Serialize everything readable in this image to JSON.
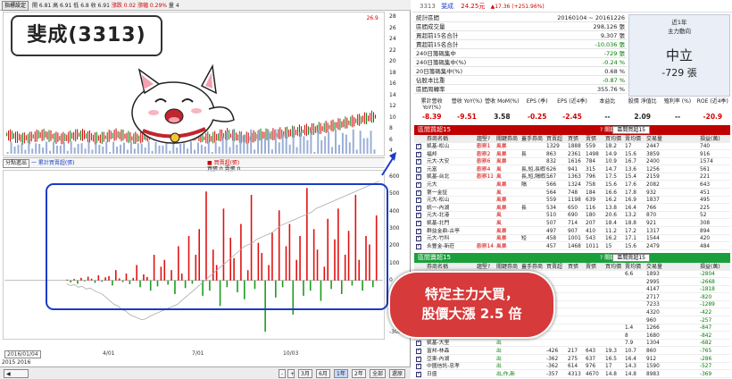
{
  "left": {
    "topbar": {
      "btn": "指標設定",
      "text": "開 6.81  高 6.91  低 6.8  收 6.91",
      "change": "漲跌 0.02  漲幅 0.29%",
      "vol": "量 4"
    },
    "title": "斐成(3313)",
    "price_axis": [
      "28",
      "26",
      "24",
      "22",
      "20",
      "18",
      "16",
      "14",
      "12",
      "10",
      "8",
      "6",
      "4"
    ],
    "price_tag": "26.9",
    "mid_bar": {
      "sel": "分點進出",
      "legend1": "一 累計買賣超(張)",
      "legend2": "■ 買賣超(張)",
      "legend3": "買張 0  賣張 0"
    },
    "vol_axis": [
      "600",
      "500",
      "400",
      "300",
      "200",
      "100",
      "0",
      "-100",
      "-200",
      "-300"
    ],
    "dates": [
      "2016/01/04",
      "4/01",
      "7/01",
      "10/03"
    ],
    "date_sub": "2015  2016",
    "bottom_buttons": [
      "3月",
      "6月",
      "1年",
      "2年",
      "全部",
      "還原"
    ]
  },
  "right": {
    "header": {
      "code": "3313",
      "name": "斐成",
      "price": "24.25元",
      "change": "▲17.36 (+251.96%)"
    },
    "stats": [
      {
        "k": "統計區間",
        "v": "20160104 ~ 20161226"
      },
      {
        "k": "區間成交量",
        "v": "298,126 張"
      },
      {
        "k": "買超前15名合計",
        "v": "9,307 張"
      },
      {
        "k": "賣超前15名合計",
        "v": "-10,036 張"
      },
      {
        "k": "240日籌碼集中",
        "v": "-729 張"
      },
      {
        "k": "240日籌碼集中(%)",
        "v": "-0.24 %"
      },
      {
        "k": "20日籌碼集中(%)",
        "v": "0.68 %"
      },
      {
        "k": "佔股本比重",
        "v": "-0.87 %"
      },
      {
        "k": "區間周轉率",
        "v": "355.76 %"
      }
    ],
    "trend": {
      "t1": "近1年",
      "t2": "主力動向",
      "t3": "中立",
      "t4": "-729 張"
    },
    "ratios": {
      "labels": [
        "累計營收 YoY(%)",
        "營收 YoY(%)",
        "營收 MoM(%)",
        "EPS (季)",
        "EPS (近4季)",
        "本益比",
        "股價 淨值比",
        "殖利率 (%)",
        "ROE (近4季)"
      ],
      "values": [
        "-8.39",
        "-9.51",
        "3.58",
        "-0.25",
        "-2.45",
        "--",
        "2.09",
        "--",
        "-20.9"
      ]
    },
    "buy": {
      "title": "區間買超15",
      "select": "區間買超15",
      "hint": "? 關鍵券商:",
      "cols": [
        "券商名稱",
        "趨堅?",
        "關鍵券商",
        "蓋手券商",
        "買賣超",
        "買張",
        "賣張",
        "買均價",
        "賣均價",
        "交易量",
        "損益(萬)"
      ],
      "rows": [
        [
          "凱基-松山",
          "觀察1",
          "風暴",
          "",
          "1329",
          "1888",
          "559",
          "18.2",
          "17",
          "2447",
          "740"
        ],
        [
          "福邦",
          "觀察2",
          "風暴",
          "長",
          "863",
          "2361",
          "1498",
          "14.9",
          "15.6",
          "3859",
          "916"
        ],
        [
          "元大-大安",
          "觀察6",
          "風暴",
          "",
          "832",
          "1616",
          "784",
          "10.9",
          "16.7",
          "2400",
          "1574"
        ],
        [
          "元富",
          "觀察4",
          "風",
          "長,短,長暇",
          "626",
          "941",
          "315",
          "14.7",
          "13.6",
          "1256",
          "561"
        ],
        [
          "凱基-台北",
          "觀察11",
          "風",
          "長,短,隔暇...",
          "567",
          "1363",
          "796",
          "17.5",
          "15.4",
          "2159",
          "221"
        ],
        [
          "元大",
          "",
          "風暴",
          "隔",
          "566",
          "1324",
          "758",
          "15.6",
          "17.6",
          "2082",
          "643"
        ],
        [
          "第一金証",
          "",
          "風",
          "",
          "564",
          "748",
          "184",
          "16.6",
          "17.8",
          "932",
          "451"
        ],
        [
          "元大-松山",
          "",
          "風暴",
          "",
          "559",
          "1198",
          "639",
          "16.2",
          "16.9",
          "1837",
          "495"
        ],
        [
          "統一-內湖",
          "",
          "風暴",
          "長",
          "534",
          "650",
          "116",
          "13.8",
          "16.4",
          "766",
          "225"
        ],
        [
          "元大-北港",
          "",
          "風",
          "",
          "510",
          "690",
          "180",
          "20.6",
          "13.2",
          "870",
          "52"
        ],
        [
          "凱基-北門",
          "",
          "風",
          "",
          "507",
          "714",
          "207",
          "18.4",
          "18.8",
          "921",
          "308"
        ],
        [
          "群益金鼎-古亭",
          "",
          "風暴",
          "",
          "497",
          "907",
          "410",
          "11.2",
          "17.2",
          "1317",
          "894"
        ],
        [
          "元大-竹科",
          "",
          "風暴",
          "短",
          "458",
          "1001",
          "543",
          "16.2",
          "17.1",
          "1544",
          "420"
        ],
        [
          "永豐金-新莊",
          "觀察14",
          "風暴",
          "",
          "457",
          "1468",
          "1011",
          "15",
          "15.6",
          "2479",
          "484"
        ]
      ]
    },
    "sell": {
      "title": "區間賣超15",
      "select": "區間賣超15",
      "hint": "? 關鍵券商:",
      "cols": [
        "券商名稱",
        "趨堅?",
        "關鍵券商",
        "蓋手券商",
        "買賣超",
        "買張",
        "賣張",
        "買均價",
        "賣均價",
        "交易量",
        "損益(萬)"
      ],
      "rows": [
        [
          "",
          "",
          "",
          "",
          "",
          "",
          "",
          "",
          "6.6",
          "1893",
          "-2804"
        ],
        [
          "",
          "",
          "",
          "",
          "",
          "",
          "",
          "",
          "",
          "2995",
          "-2668"
        ],
        [
          "",
          "",
          "",
          "",
          "",
          "",
          "",
          "",
          "",
          "4147",
          "-1818"
        ],
        [
          "",
          "",
          "",
          "",
          "",
          "",
          "",
          "",
          "",
          "2717",
          "-820"
        ],
        [
          "",
          "",
          "",
          "",
          "",
          "",
          "",
          "",
          "",
          "7233",
          "-1289"
        ],
        [
          "",
          "",
          "",
          "",
          "",
          "",
          "",
          "",
          "",
          "4320",
          "-422"
        ],
        [
          "",
          "",
          "",
          "",
          "",
          "",
          "",
          "",
          "",
          "960",
          "-257"
        ],
        [
          "",
          "",
          "",
          "",
          "",
          "",
          "",
          "",
          "1.4",
          "1266",
          "-847"
        ],
        [
          "",
          "",
          "",
          "",
          "",
          "",
          "",
          "",
          "8",
          "1680",
          "-842"
        ],
        [
          "凱基-大里",
          "",
          "出",
          "",
          "",
          "",
          "",
          "",
          "7.9",
          "1304",
          "-682"
        ],
        [
          "富邦-林森",
          "",
          "出",
          "",
          "-426",
          "217",
          "643",
          "19.3",
          "10.7",
          "860",
          "-765"
        ],
        [
          "亞東-內湖",
          "",
          "出",
          "",
          "-362",
          "275",
          "637",
          "16.5",
          "16.4",
          "912",
          "-286"
        ],
        [
          "中國信託-忠孝",
          "",
          "出",
          "",
          "-362",
          "614",
          "976",
          "17",
          "14.3",
          "1590",
          "-527"
        ],
        [
          "日盛",
          "",
          "出,作,新",
          "",
          "-357",
          "4313",
          "4670",
          "14.8",
          "14.8",
          "8983",
          "-369"
        ]
      ]
    }
  },
  "callout": {
    "line1": "特定主力大買，",
    "line2": "股價大漲 2.5 倍"
  },
  "chart_data": {
    "type": "bar",
    "title": "",
    "xlabel": "",
    "ylabel": "",
    "ylim": [
      -300,
      600
    ],
    "series": [
      {
        "name": "買賣超(張)",
        "values": [
          5,
          -12,
          8,
          -20,
          15,
          -6,
          22,
          10,
          -15,
          30,
          -8,
          18,
          25,
          -30,
          60,
          12,
          -10,
          40,
          -22,
          15,
          90,
          -40,
          35,
          20,
          -60,
          150,
          -35,
          80,
          120,
          -25,
          60,
          -80,
          200,
          40,
          -45,
          260,
          -20,
          150,
          300,
          -90,
          520,
          -60,
          180,
          90,
          -150,
          420,
          -40,
          250,
          130,
          -70,
          330,
          -110,
          60,
          500,
          -50,
          220,
          160,
          -300,
          90,
          280,
          -100,
          410,
          -40,
          200,
          330,
          -200,
          120,
          260,
          -90,
          540,
          -60,
          300,
          180,
          -120,
          80,
          360,
          -50,
          240,
          420,
          -80,
          150,
          290,
          -30,
          500,
          120,
          -60,
          260,
          210,
          -40,
          380
        ]
      },
      {
        "name": "累計買賣超(張)",
        "values": [
          -20,
          -30,
          -25,
          -40,
          -35,
          -50,
          -45,
          -60,
          -70,
          -80,
          -100,
          -120,
          -140,
          -150,
          -170,
          -180,
          -200,
          -210,
          -220,
          -230,
          -225,
          -210,
          -200,
          -190,
          -180,
          -170,
          -160,
          -150,
          -140,
          -120,
          -100,
          -80,
          -60,
          -40,
          -20,
          0,
          20,
          40,
          60,
          80,
          100,
          120,
          140,
          160,
          180,
          200,
          210,
          220,
          240,
          250,
          260,
          270,
          280,
          300,
          320,
          330,
          340,
          350,
          360,
          370,
          380,
          390,
          400,
          420,
          430,
          440,
          450,
          460,
          470,
          480,
          490,
          500,
          510,
          520,
          530,
          540,
          550,
          560,
          570,
          580
        ]
      }
    ]
  }
}
